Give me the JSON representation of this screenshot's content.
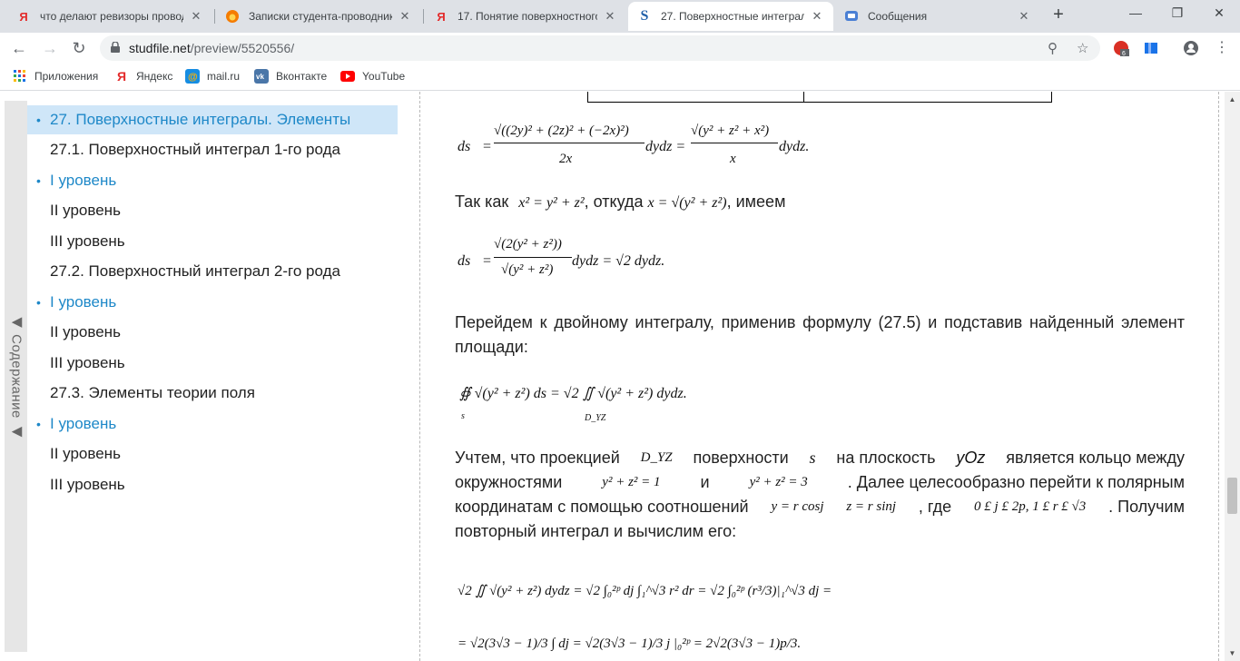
{
  "browser": {
    "tabs": [
      {
        "label": "что делают ревизоры провод",
        "favicon": "Я"
      },
      {
        "label": "Записки студента-проводник",
        "favicon": "●"
      },
      {
        "label": "17. Понятие поверхностного",
        "favicon": "Я"
      },
      {
        "label": "27. Поверхностные интегралы",
        "favicon": "S"
      },
      {
        "label": "Сообщения",
        "favicon": "▪"
      }
    ],
    "close_glyph": "✕",
    "new_tab_glyph": "+",
    "url_host": "studfile.net",
    "url_path": "/preview/5520556/",
    "extension_badge": "6",
    "bookmarks": [
      {
        "label": "Приложения"
      },
      {
        "label": "Яндекс"
      },
      {
        "label": "mail.ru"
      },
      {
        "label": "Вконтакте"
      },
      {
        "label": "YouTube"
      }
    ]
  },
  "toc": {
    "tab_label": "◀ Содержание ◀",
    "items": [
      {
        "label": "27. Поверхностные интегралы. Элементы",
        "style": "active"
      },
      {
        "label": "27.1. Поверхностный интеграл 1-го рода",
        "style": "plain"
      },
      {
        "label": "I уровень",
        "style": "bullet"
      },
      {
        "label": "II уровень",
        "style": "plain"
      },
      {
        "label": "III уровень",
        "style": "plain"
      },
      {
        "label": "27.2. Поверхностный интеграл 2-го рода",
        "style": "plain"
      },
      {
        "label": "I уровень",
        "style": "bullet"
      },
      {
        "label": "II уровень",
        "style": "plain"
      },
      {
        "label": "III уровень",
        "style": "plain"
      },
      {
        "label": "27.3. Элементы теории поля",
        "style": "plain"
      },
      {
        "label": "I уровень",
        "style": "bullet"
      },
      {
        "label": "II уровень",
        "style": "plain"
      },
      {
        "label": "III уровень",
        "style": "plain"
      }
    ]
  },
  "document": {
    "text_since_a": "Так как",
    "text_since_b": ", откуда",
    "text_since_c": ", имеем",
    "para_double_integral": "Перейдем к двойному интегралу, применив формулу (27.5) и подставив найденный элемент площади:",
    "para_projection_1": "Учтем, что проекцией",
    "para_projection_2": "поверхности",
    "para_projection_3": "на плоскость",
    "para_projection_4": "является кольцо между",
    "para_circles_1": "окружностями",
    "para_circles_2": "и",
    "para_circles_3": ". Далее целесообразно перейти к полярным",
    "para_polar_1": "координатам с помощью соотношений",
    "para_polar_2": ", где",
    "para_polar_3": ". Получим",
    "para_repeat": "повторный интеграл и вычислим его:",
    "formulas": {
      "f1_lhs": "ds",
      "f1_num1": "√((2y)² + (2z)² + (−2x)²)",
      "f1_den1": "2x",
      "f1_mid": "dydz =",
      "f1_num2": "√(y² + z² + x²)",
      "f1_den2": "x",
      "f1_end": "dydz.",
      "since_eq": "x² = y² + z²",
      "since_x": "x = √(y² + z²)",
      "f2_lhs": "ds",
      "f2_num": "√(2(y² + z²))",
      "f2_den": "√(y² + z²)",
      "f2_end": "dydz = √2 dydz.",
      "f3_left": "∯ √(y² + z²) ds = √2 ∬ √(y² + z²) dydz.",
      "f3_sub1": "s",
      "f3_sub2": "D_YZ",
      "proj_dyz": "D_YZ",
      "proj_s": "s",
      "proj_plane": "yOz",
      "circle1": "y² + z² = 1",
      "circle2": "y² + z² = 3",
      "polar1": "y = r cosj",
      "polar2": "z = r sinj",
      "polar_range": "0 £ j £ 2p, 1 £ r £ √3",
      "f4_line1": "√2 ∬ √(y² + z²) dydz = √2 ∫₀²ᵖ dj ∫₁^√3 r² dr = √2 ∫₀²ᵖ (r³/3)|₁^√3 dj =",
      "f4_line2": "= √2(3√3 − 1)/3 ∫ dj = √2(3√3 − 1)/3 j |₀²ᵖ = 2√2(3√3 − 1)p/3."
    }
  }
}
